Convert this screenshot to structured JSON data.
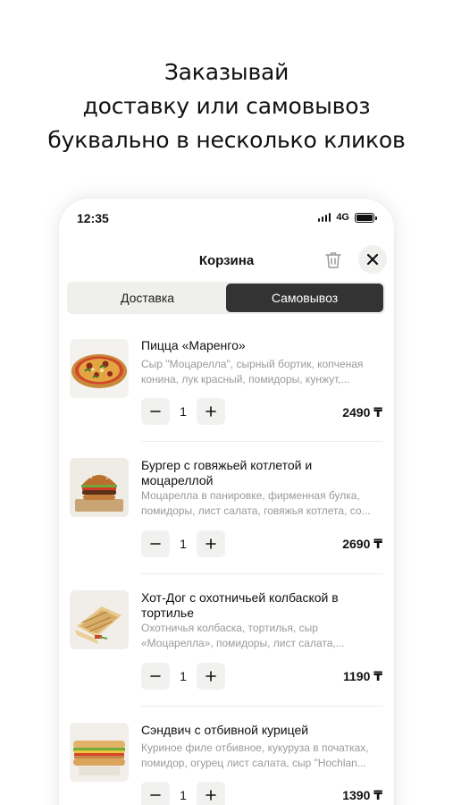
{
  "headline": {
    "line1": "Заказывай",
    "line2": "доставку или самовывоз",
    "line3": "буквально в несколько кликов"
  },
  "status_bar": {
    "time": "12:35",
    "network": "4G"
  },
  "header": {
    "title": "Корзина",
    "trash_icon": "trash-icon",
    "close_icon": "close-icon"
  },
  "delivery_mode": {
    "options": [
      "Доставка",
      "Самовывоз"
    ],
    "selected": "Самовывоз"
  },
  "cart_items": [
    {
      "name": "Пицца «Маренго»",
      "description": "Сыр \"Моцарелла\", сырный бортик, копченая конина, лук красный, помидоры, кунжут,...",
      "quantity": "1",
      "price": "2490 ₸"
    },
    {
      "name": "Бургер с говяжьей котлетой и моцареллой",
      "description": "Моцарелла в панировке, фирменная булка, помидоры, лист салата, говяжья котлета, со...",
      "quantity": "1",
      "price": "2690 ₸"
    },
    {
      "name": "Хот-Дог с охотничьей колбаской в тортилье",
      "description": "Охотничья колбаска, тортилья, сыр «Моцарелла», помидоры, лист салата,...",
      "quantity": "1",
      "price": "1190 ₸"
    },
    {
      "name": "Сэндвич с отбивной курицей",
      "description": "Куриное филе отбивное, кукуруза в початках, помидор, огурец лист салата, сыр \"Hochlan...",
      "quantity": "1",
      "price": "1390 ₸"
    }
  ],
  "labels": {
    "minus": "−",
    "plus": "+"
  },
  "colors": {
    "segment_active_bg": "#333333",
    "button_bg": "#f1f1ef",
    "description_text": "#9a9a9a"
  }
}
